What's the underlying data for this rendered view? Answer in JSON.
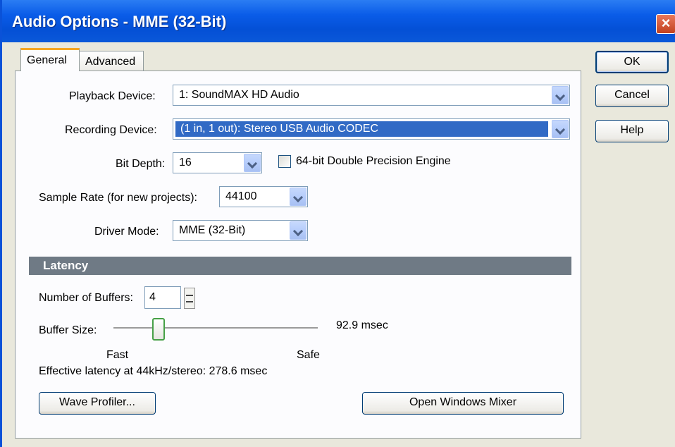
{
  "window": {
    "title": "Audio Options - MME (32-Bit)",
    "close_label": "×"
  },
  "tabs": {
    "general": "General",
    "advanced": "Advanced"
  },
  "fields": {
    "playback_label": "Playback Device:",
    "playback_value": "1: SoundMAX HD Audio",
    "recording_label": "Recording Device:",
    "recording_value": "(1 in, 1 out): Stereo USB Audio CODEC",
    "bitdepth_label": "Bit Depth:",
    "bitdepth_value": "16",
    "double_precision_label": "64-bit Double Precision Engine",
    "double_precision_checked": false,
    "samplerate_label": "Sample Rate (for new projects):",
    "samplerate_value": "44100",
    "drivermode_label": "Driver Mode:",
    "drivermode_value": "MME (32-Bit)"
  },
  "latency": {
    "header": "Latency",
    "buffers_label": "Number of Buffers:",
    "buffers_value": "4",
    "buffersize_label": "Buffer Size:",
    "buffersize_value": "92.9 msec",
    "buffersize_fraction": 0.23,
    "fast_label": "Fast",
    "safe_label": "Safe",
    "effective_latency": "Effective latency at 44kHz/stereo:  278.6 msec"
  },
  "buttons": {
    "wave_profiler": "Wave Profiler...",
    "open_mixer": "Open Windows Mixer",
    "ok": "OK",
    "cancel": "Cancel",
    "help": "Help"
  },
  "colors": {
    "titlebar": "#0a5ce8",
    "selection": "#316ac5",
    "section_header": "#6f7a85"
  }
}
